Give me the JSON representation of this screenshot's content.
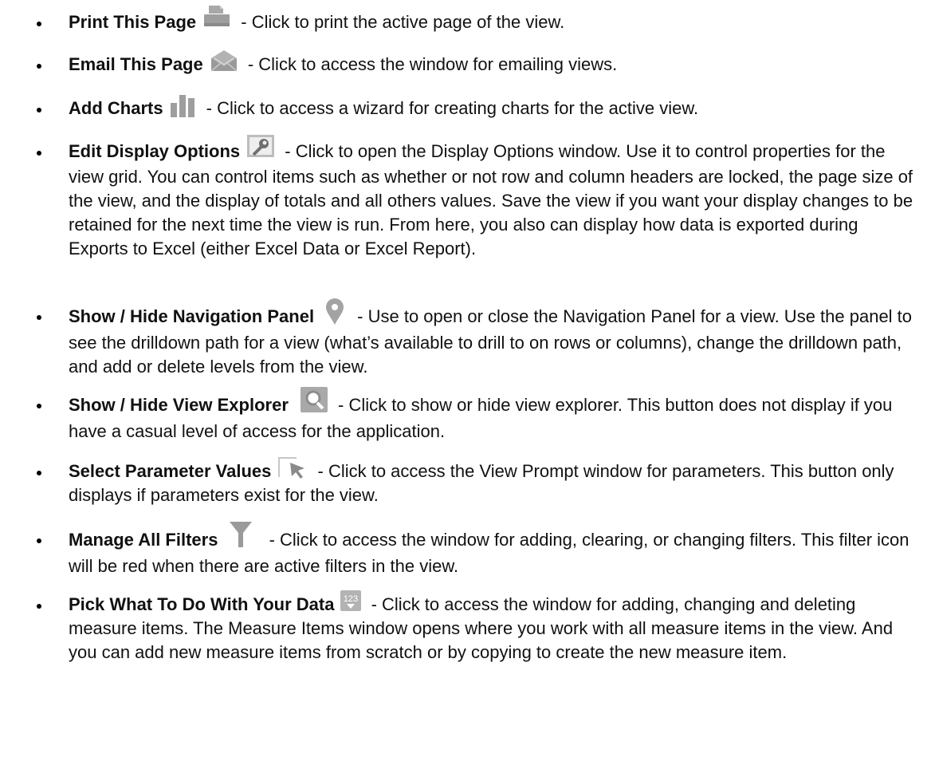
{
  "items": [
    {
      "title": "Print This Page",
      "icon": "printer-icon",
      "desc": " - Click to print the active page of the view."
    },
    {
      "title": "Email This Page",
      "icon": "envelope-icon",
      "desc": " - Click to access the window for emailing views."
    },
    {
      "title": "Add Charts",
      "icon": "bar-chart-icon",
      "desc": " - Click to access a wizard for creating charts for the active view."
    },
    {
      "title": "Edit Display Options",
      "icon": "display-options-icon",
      "desc": " - Click to open the Display Options window. Use it to control properties for the view grid. You can control items such as whether or not row and column headers are locked, the page size of the view, and the display of totals and all others values. Save the view if you want your display changes to be retained for the next time the view is run. From here, you also can display how data is exported during Exports to Excel (either Excel Data or Excel Report)."
    },
    {
      "title": "Show / Hide Navigation Panel",
      "icon": "map-pin-icon",
      "desc": " - Use to open or close the Navigation Panel for a view. Use the panel to see the drilldown path for a view (what’s available to drill to on rows or columns), change the drilldown path, and add or delete levels from the view."
    },
    {
      "title": "Show / Hide View Explorer",
      "icon": "magnifier-icon",
      "desc": " - Click to show or hide view explorer. This button does not display if you have a casual level of access for the application."
    },
    {
      "title": "Select Parameter Values",
      "icon": "cursor-arrow-icon",
      "desc": " - Click to access the View Prompt window for parameters. This button only displays if parameters exist for the view."
    },
    {
      "title": "Manage All Filters",
      "icon": "filter-funnel-icon",
      "desc": " - Click to access the window for adding, clearing, or changing filters. This filter icon will be red when there are active filters in the view."
    },
    {
      "title": "Pick What To Do With Your Data",
      "icon": "measure-123-icon",
      "icon_text": "123",
      "desc": " - Click to access the window for adding, changing and deleting measure items. The Measure Items window opens where you work with all measure items in the view. And you can add new measure items from scratch or by copying to create the new measure item."
    }
  ]
}
